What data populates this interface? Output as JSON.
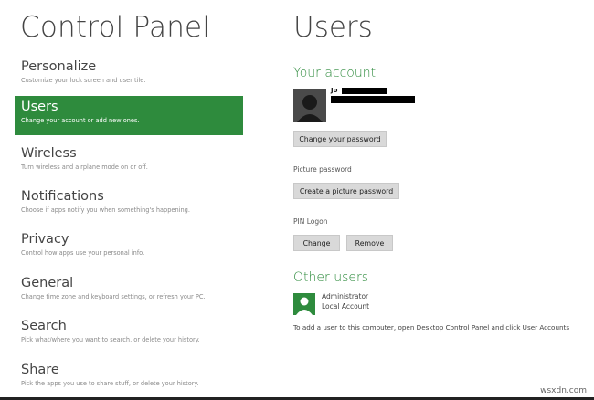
{
  "left_title": "Control Panel",
  "nav": [
    {
      "label": "Personalize",
      "desc": "Customize your lock screen and user tile."
    },
    {
      "label": "Users",
      "desc": "Change your account or add new ones."
    },
    {
      "label": "Wireless",
      "desc": "Turn wireless and airplane mode on or off."
    },
    {
      "label": "Notifications",
      "desc": "Choose if apps notify you when something's happening."
    },
    {
      "label": "Privacy",
      "desc": "Control how apps use your personal info."
    },
    {
      "label": "General",
      "desc": "Change time zone and keyboard settings, or refresh your PC."
    },
    {
      "label": "Search",
      "desc": "Pick what/where you want to search, or delete your history."
    },
    {
      "label": "Share",
      "desc": "Pick the apps you use to share stuff, or delete your history."
    }
  ],
  "selected_nav": "Users",
  "right_title": "Users",
  "your_account": {
    "heading": "Your account",
    "name_fragment": "Jo",
    "change_password_button": "Change your password",
    "picture_password_label": "Picture password",
    "create_picture_password_button": "Create a picture password",
    "pin_logon_label": "PIN Logon",
    "pin_change_button": "Change",
    "pin_remove_button": "Remove"
  },
  "other_users": {
    "heading": "Other users",
    "users": [
      {
        "name": "Administrator",
        "type": "Local Account"
      }
    ],
    "footnote": "To add a user to this computer, open Desktop Control Panel and click User Accounts"
  },
  "watermark": "wsxdn.com",
  "colors": {
    "accent": "#2e8b3d",
    "button_bg": "#d9d9d9"
  }
}
